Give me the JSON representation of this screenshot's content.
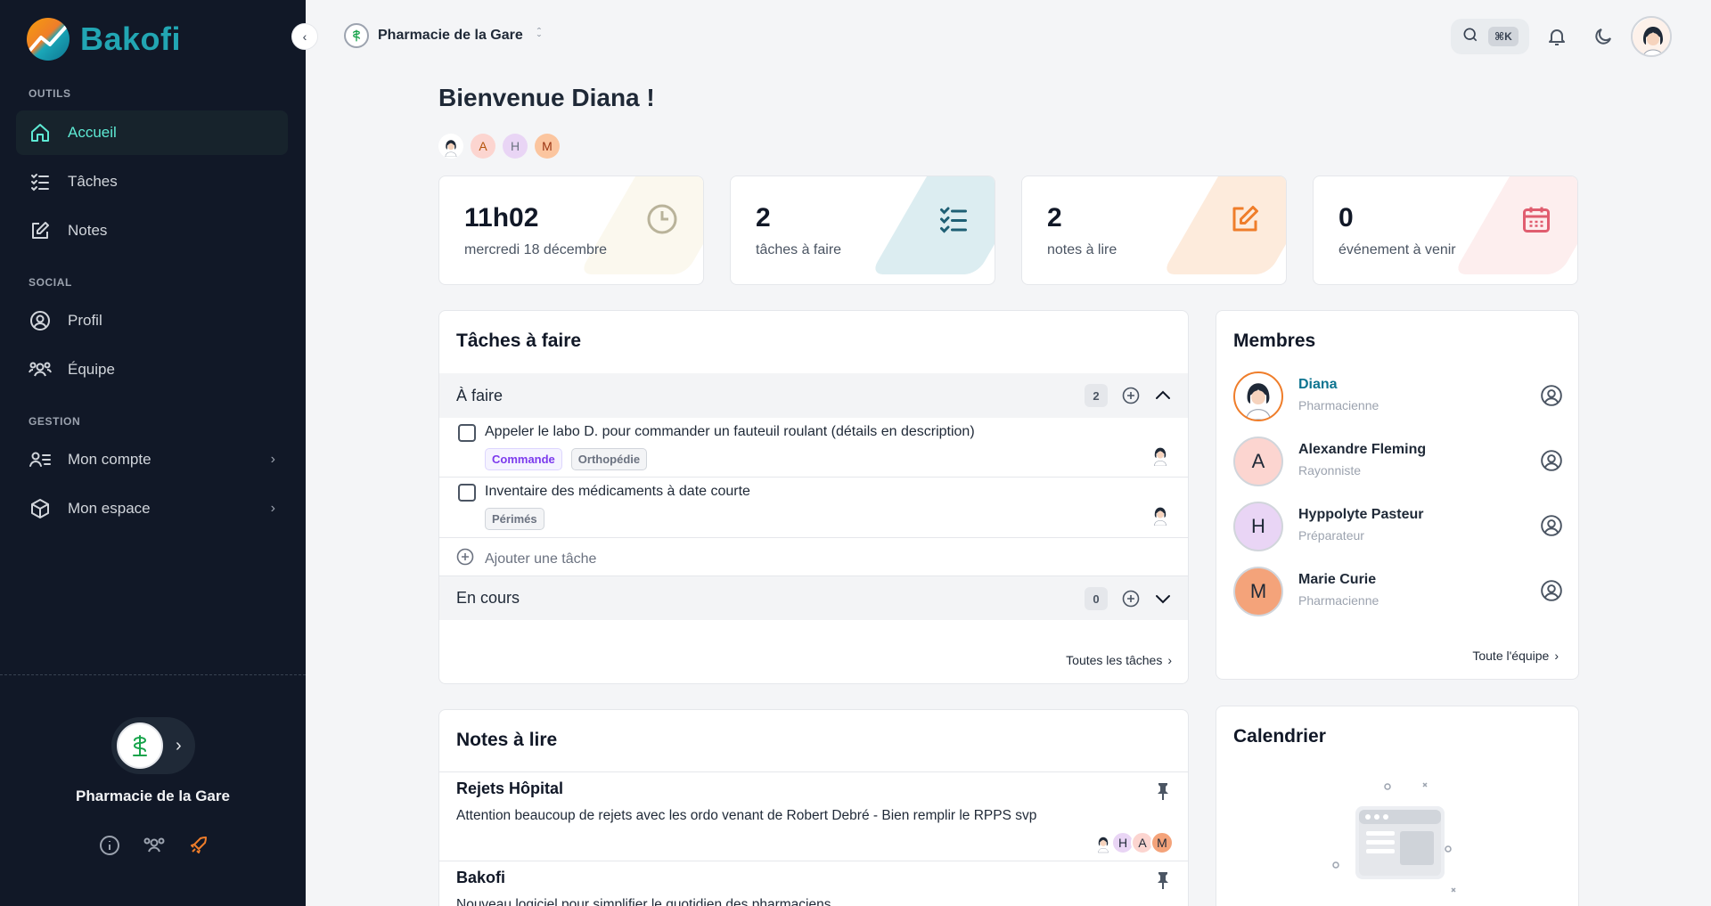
{
  "brand": {
    "name": "Bakofi"
  },
  "sidebar": {
    "sections": [
      {
        "label": "OUTILS"
      },
      {
        "label": "SOCIAL"
      },
      {
        "label": "GESTION"
      }
    ],
    "items": [
      {
        "label": "Accueil",
        "icon": "home-icon"
      },
      {
        "label": "Tâches",
        "icon": "checklist-icon"
      },
      {
        "label": "Notes",
        "icon": "edit-icon"
      },
      {
        "label": "Profil",
        "icon": "user-circle-icon"
      },
      {
        "label": "Équipe",
        "icon": "team-icon"
      },
      {
        "label": "Mon compte",
        "icon": "account-icon"
      },
      {
        "label": "Mon espace",
        "icon": "box-icon"
      }
    ],
    "org_name": "Pharmacie de la Gare"
  },
  "topbar": {
    "org_name": "Pharmacie de la Gare",
    "shortcut": "⌘K"
  },
  "welcome": "Bienvenue Diana !",
  "team_initials": [
    "A",
    "H",
    "M"
  ],
  "stats": [
    {
      "value": "11h02",
      "label": "mercredi 18 décembre",
      "color": "#b9b39a"
    },
    {
      "value": "2",
      "label": "tâches à faire",
      "color": "#1e5f74"
    },
    {
      "value": "2",
      "label": "notes à lire",
      "color": "#ef7d2a"
    },
    {
      "value": "0",
      "label": "événement à venir",
      "color": "#e05d6f"
    }
  ],
  "tasks_panel": {
    "title": "Tâches à faire",
    "todo_label": "À faire",
    "todo_count": "2",
    "tasks": [
      {
        "text": "Appeler le labo D. pour commander un fauteuil roulant (détails en description)",
        "tags": [
          "Commande",
          "Orthopédie"
        ]
      },
      {
        "text": "Inventaire des médicaments à date courte",
        "tags": [
          "Périmés"
        ]
      }
    ],
    "add_label": "Ajouter une tâche",
    "in_progress_label": "En cours",
    "in_progress_count": "0",
    "all_link": "Toutes les tâches"
  },
  "members_panel": {
    "title": "Membres",
    "members": [
      {
        "name": "Diana",
        "role": "Pharmacienne",
        "initial": ""
      },
      {
        "name": "Alexandre Fleming",
        "role": "Rayonniste",
        "initial": "A"
      },
      {
        "name": "Hyppolyte Pasteur",
        "role": "Préparateur",
        "initial": "H"
      },
      {
        "name": "Marie Curie",
        "role": "Pharmacienne",
        "initial": "M"
      }
    ],
    "all_link": "Toute l'équipe"
  },
  "notes_panel": {
    "title": "Notes à lire",
    "notes": [
      {
        "title": "Rejets Hôpital",
        "body": "Attention beaucoup de rejets avec les ordo venant de Robert Debré - Bien remplir le RPPS svp"
      },
      {
        "title": "Bakofi",
        "body": "Nouveau logiciel pour simplifier le quotidien des pharmaciens"
      }
    ]
  },
  "calendar_panel": {
    "title": "Calendrier"
  },
  "colors": {
    "accent": "#5eead4",
    "brand": "#22a6b3",
    "sidebar_bg": "#111827",
    "orange": "#ef7d2a"
  }
}
